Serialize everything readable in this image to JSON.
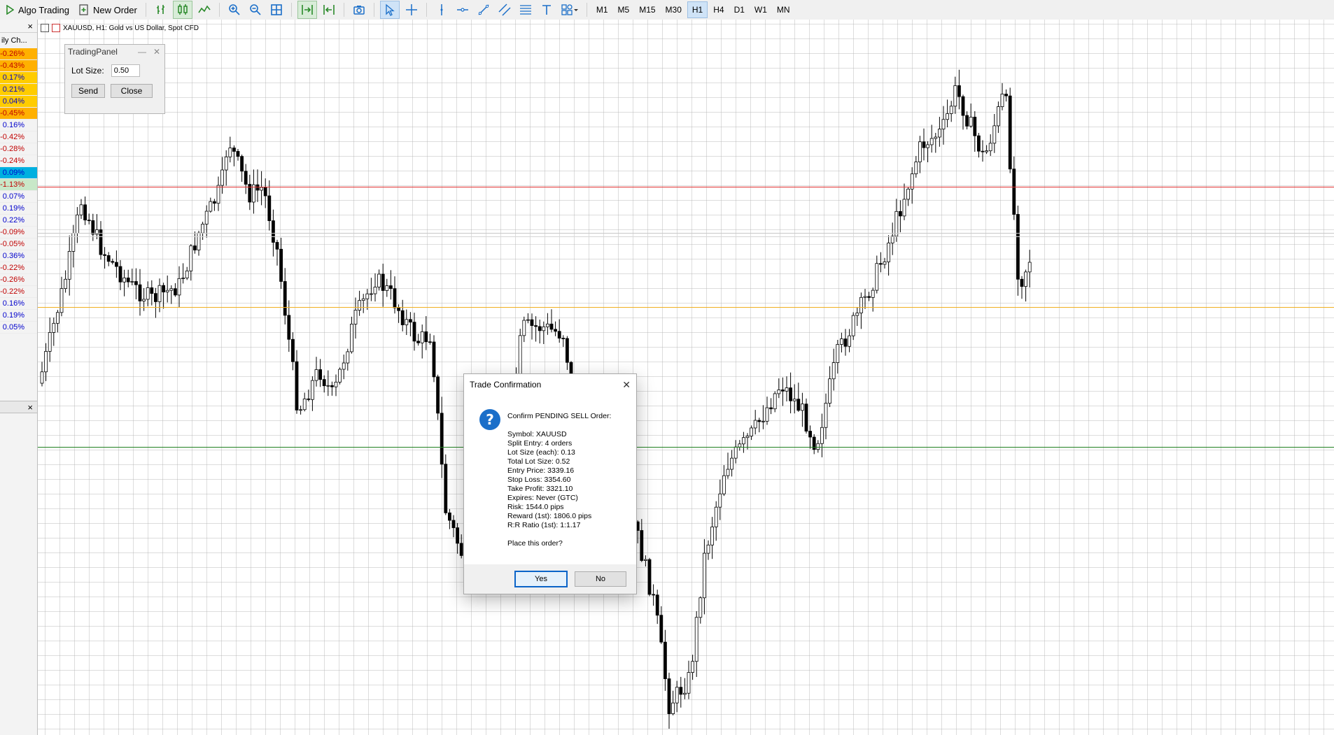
{
  "toolbar": {
    "algo_trading": "Algo Trading",
    "new_order": "New Order",
    "timeframes": [
      "M1",
      "M5",
      "M15",
      "M30",
      "H1",
      "H4",
      "D1",
      "W1",
      "MN"
    ],
    "active_timeframe": "H1"
  },
  "left_panel": {
    "title": "ily Ch...",
    "close_icon": "×",
    "values": [
      {
        "text": "-0.26%",
        "bg": "#ffb000",
        "color": "#c00000"
      },
      {
        "text": "-0.43%",
        "bg": "#ffb000",
        "color": "#c00000"
      },
      {
        "text": "0.17%",
        "bg": "#ffcc00",
        "color": "#0000cc"
      },
      {
        "text": "0.21%",
        "bg": "#ffcc00",
        "color": "#0000cc"
      },
      {
        "text": "0.04%",
        "bg": "#ffcc00",
        "color": "#0000cc"
      },
      {
        "text": "-0.45%",
        "bg": "#ffb000",
        "color": "#c00000"
      },
      {
        "text": "0.16%",
        "bg": "#f3f3f3",
        "color": "#0000cc"
      },
      {
        "text": "-0.42%",
        "bg": "#f3f3f3",
        "color": "#c00000"
      },
      {
        "text": "-0.28%",
        "bg": "#f3f3f3",
        "color": "#c00000"
      },
      {
        "text": "-0.24%",
        "bg": "#f3f3f3",
        "color": "#c00000"
      },
      {
        "text": "0.09%",
        "bg": "#00b0e0",
        "color": "#0000cc"
      },
      {
        "text": "-1.13%",
        "bg": "#c8e8c8",
        "color": "#c00000"
      },
      {
        "text": "0.07%",
        "bg": "#f3f3f3",
        "color": "#0000cc"
      },
      {
        "text": "0.19%",
        "bg": "#f3f3f3",
        "color": "#0000cc"
      },
      {
        "text": "0.22%",
        "bg": "#f3f3f3",
        "color": "#0000cc"
      },
      {
        "text": "-0.09%",
        "bg": "#f3f3f3",
        "color": "#c00000"
      },
      {
        "text": "-0.05%",
        "bg": "#f3f3f3",
        "color": "#c00000"
      },
      {
        "text": "0.36%",
        "bg": "#f3f3f3",
        "color": "#0000cc"
      },
      {
        "text": "-0.22%",
        "bg": "#f3f3f3",
        "color": "#c00000"
      },
      {
        "text": "-0.26%",
        "bg": "#f3f3f3",
        "color": "#c00000"
      },
      {
        "text": "-0.22%",
        "bg": "#f3f3f3",
        "color": "#c00000"
      },
      {
        "text": "0.16%",
        "bg": "#f3f3f3",
        "color": "#0000cc"
      },
      {
        "text": "0.19%",
        "bg": "#f3f3f3",
        "color": "#0000cc"
      },
      {
        "text": "0.05%",
        "bg": "#f3f3f3",
        "color": "#0000cc"
      }
    ]
  },
  "chart": {
    "title": "XAUUSD, H1:  Gold vs US Dollar, Spot CFD",
    "lines": {
      "red": "#e03030",
      "orange": "#f0b020",
      "green": "#208020",
      "gray": "#c8c8c8"
    }
  },
  "trading_panel": {
    "title": "TradingPanel",
    "lot_label": "Lot Size:",
    "lot_value": "0.50",
    "send": "Send",
    "close": "Close"
  },
  "dialog": {
    "title": "Trade Confirmation",
    "heading": "Confirm PENDING SELL Order:",
    "lines": [
      "Symbol: XAUUSD",
      "Split Entry: 4 orders",
      "Lot Size (each): 0.13",
      "Total Lot Size: 0.52",
      "Entry Price: 3339.16",
      "Stop Loss: 3354.60",
      "Take Profit: 3321.10",
      "Expires: Never (GTC)",
      "Risk: 1544.0 pips",
      "Reward (1st): 1806.0 pips",
      "R:R Ratio (1st): 1:1.17"
    ],
    "question": "Place this order?",
    "yes": "Yes",
    "no": "No"
  }
}
